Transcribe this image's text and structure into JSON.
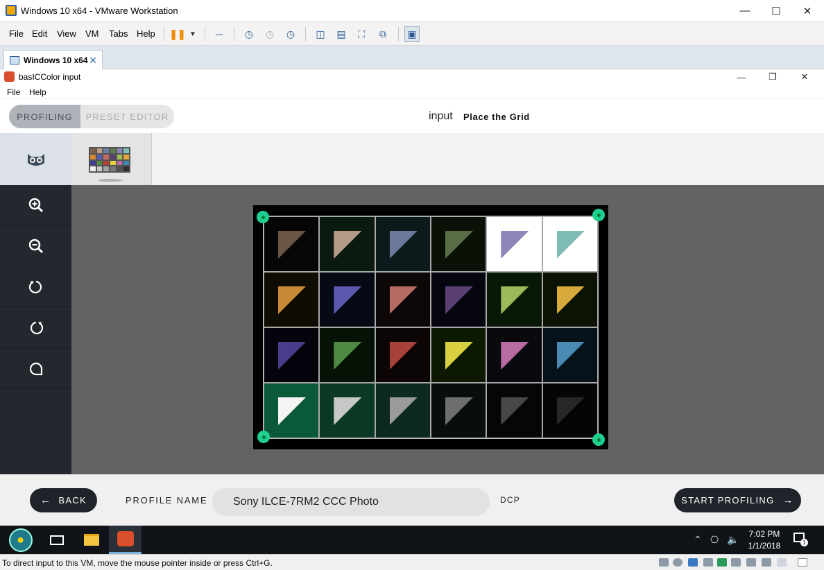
{
  "vm": {
    "window_title": "Windows 10 x64 - VMware Workstation",
    "menu": [
      "File",
      "Edit",
      "View",
      "VM",
      "Tabs",
      "Help"
    ],
    "tab_label": "Windows 10 x64",
    "status_message": "To direct input to this VM, move the mouse pointer inside or press Ctrl+G."
  },
  "app": {
    "window_title": "basICColor input",
    "menu": [
      "File",
      "Help"
    ],
    "mode_tabs": [
      "PROFILING",
      "PRESET EDITOR"
    ],
    "header_title": "input",
    "header_subtitle": "Place the Grid",
    "sidebar_tools": [
      "zoom-in-icon",
      "zoom-out-icon",
      "rotate-left-icon",
      "rotate-right-icon",
      "reset-rotation-icon"
    ],
    "patch_colors": [
      "#6b5545",
      "#b59a86",
      "#6b7a9c",
      "#5a6e46",
      "#8f86b8",
      "#7fbcb3",
      "#c98a35",
      "#5c58b0",
      "#b56b63",
      "#5a3f72",
      "#9bbb5a",
      "#d8aa3c",
      "#4a3c8c",
      "#4f8a45",
      "#a8403a",
      "#d8d040",
      "#b86ba2",
      "#4a8ab5",
      "#f4f4f4",
      "#c8c8c8",
      "#9a9a9a",
      "#6e6e6e",
      "#474747",
      "#282828"
    ],
    "patch_backgrounds": [
      "#060606",
      "#0b1a10",
      "#0c1a1c",
      "#0a1208",
      "#ffffff",
      "#ffffff",
      "#0f0c04",
      "#050a14",
      "#0e0707",
      "#060610",
      "#081806",
      "#0c1204",
      "#04040c",
      "#061206",
      "#0c0505",
      "#0c1800",
      "#0a0a0e",
      "#06121a",
      "#0a5a3a",
      "#0a3a26",
      "#0c2a1e",
      "#080e0a",
      "#060606",
      "#050505"
    ],
    "footer": {
      "back_label": "BACK",
      "profile_name_label": "PROFILE NAME",
      "profile_name_value": "Sony ILCE-7RM2 CCC Photo",
      "format_label": "DCP",
      "start_label": "START PROFILING"
    }
  },
  "taskbar": {
    "time": "7:02 PM",
    "date": "1/1/2018",
    "notification_count": "1"
  }
}
